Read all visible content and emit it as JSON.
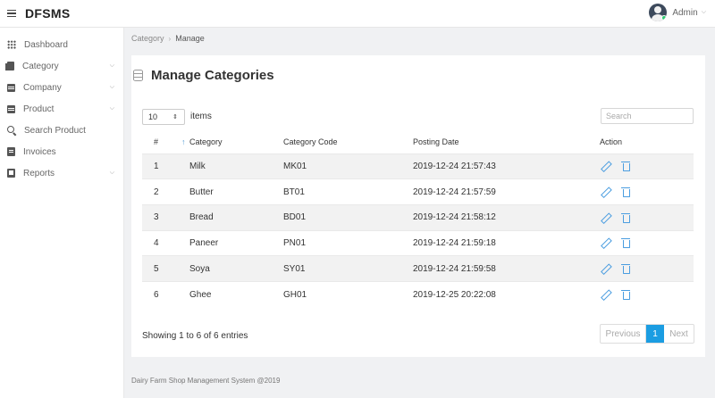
{
  "app": {
    "brand": "DFSMS"
  },
  "user": {
    "name": "Admin"
  },
  "sidebar": {
    "items": [
      {
        "label": "Dashboard",
        "icon": "grid-icon",
        "has_caret": false
      },
      {
        "label": "Category",
        "icon": "file-icon",
        "has_caret": true
      },
      {
        "label": "Company",
        "icon": "book-icon",
        "has_caret": true
      },
      {
        "label": "Product",
        "icon": "list-icon",
        "has_caret": true
      },
      {
        "label": "Search Product",
        "icon": "search-icon",
        "has_caret": false
      },
      {
        "label": "Invoices",
        "icon": "invoice-icon",
        "has_caret": false
      },
      {
        "label": "Reports",
        "icon": "report-icon",
        "has_caret": true
      }
    ]
  },
  "breadcrumb": {
    "parent": "Category",
    "separator": "›",
    "current": "Manage"
  },
  "page": {
    "title": "Manage Categories",
    "length_value": "10",
    "length_suffix": "items",
    "search_placeholder": "Search"
  },
  "table": {
    "headers": {
      "num": "#",
      "category": "Category",
      "code": "Category Code",
      "date": "Posting Date",
      "action": "Action"
    },
    "sort_arrow": "↑",
    "rows": [
      {
        "num": "1",
        "category": "Milk",
        "code": "MK01",
        "date": "2019-12-24 21:57:43"
      },
      {
        "num": "2",
        "category": "Butter",
        "code": "BT01",
        "date": "2019-12-24 21:57:59"
      },
      {
        "num": "3",
        "category": "Bread",
        "code": "BD01",
        "date": "2019-12-24 21:58:12"
      },
      {
        "num": "4",
        "category": "Paneer",
        "code": "PN01",
        "date": "2019-12-24 21:59:18"
      },
      {
        "num": "5",
        "category": "Soya",
        "code": "SY01",
        "date": "2019-12-24 21:59:58"
      },
      {
        "num": "6",
        "category": "Ghee",
        "code": "GH01",
        "date": "2019-12-25 20:22:08"
      }
    ]
  },
  "pagination": {
    "info": "Showing 1 to 6 of 6 entries",
    "previous": "Previous",
    "current_page": "1",
    "next": "Next",
    "active_color": "#1b9de2"
  },
  "footer": {
    "text": "Dairy Farm Shop Management System @2019"
  },
  "colors": {
    "accent": "#1b9de2",
    "action_icon": "#4a9de0",
    "online": "#2ecc71"
  }
}
